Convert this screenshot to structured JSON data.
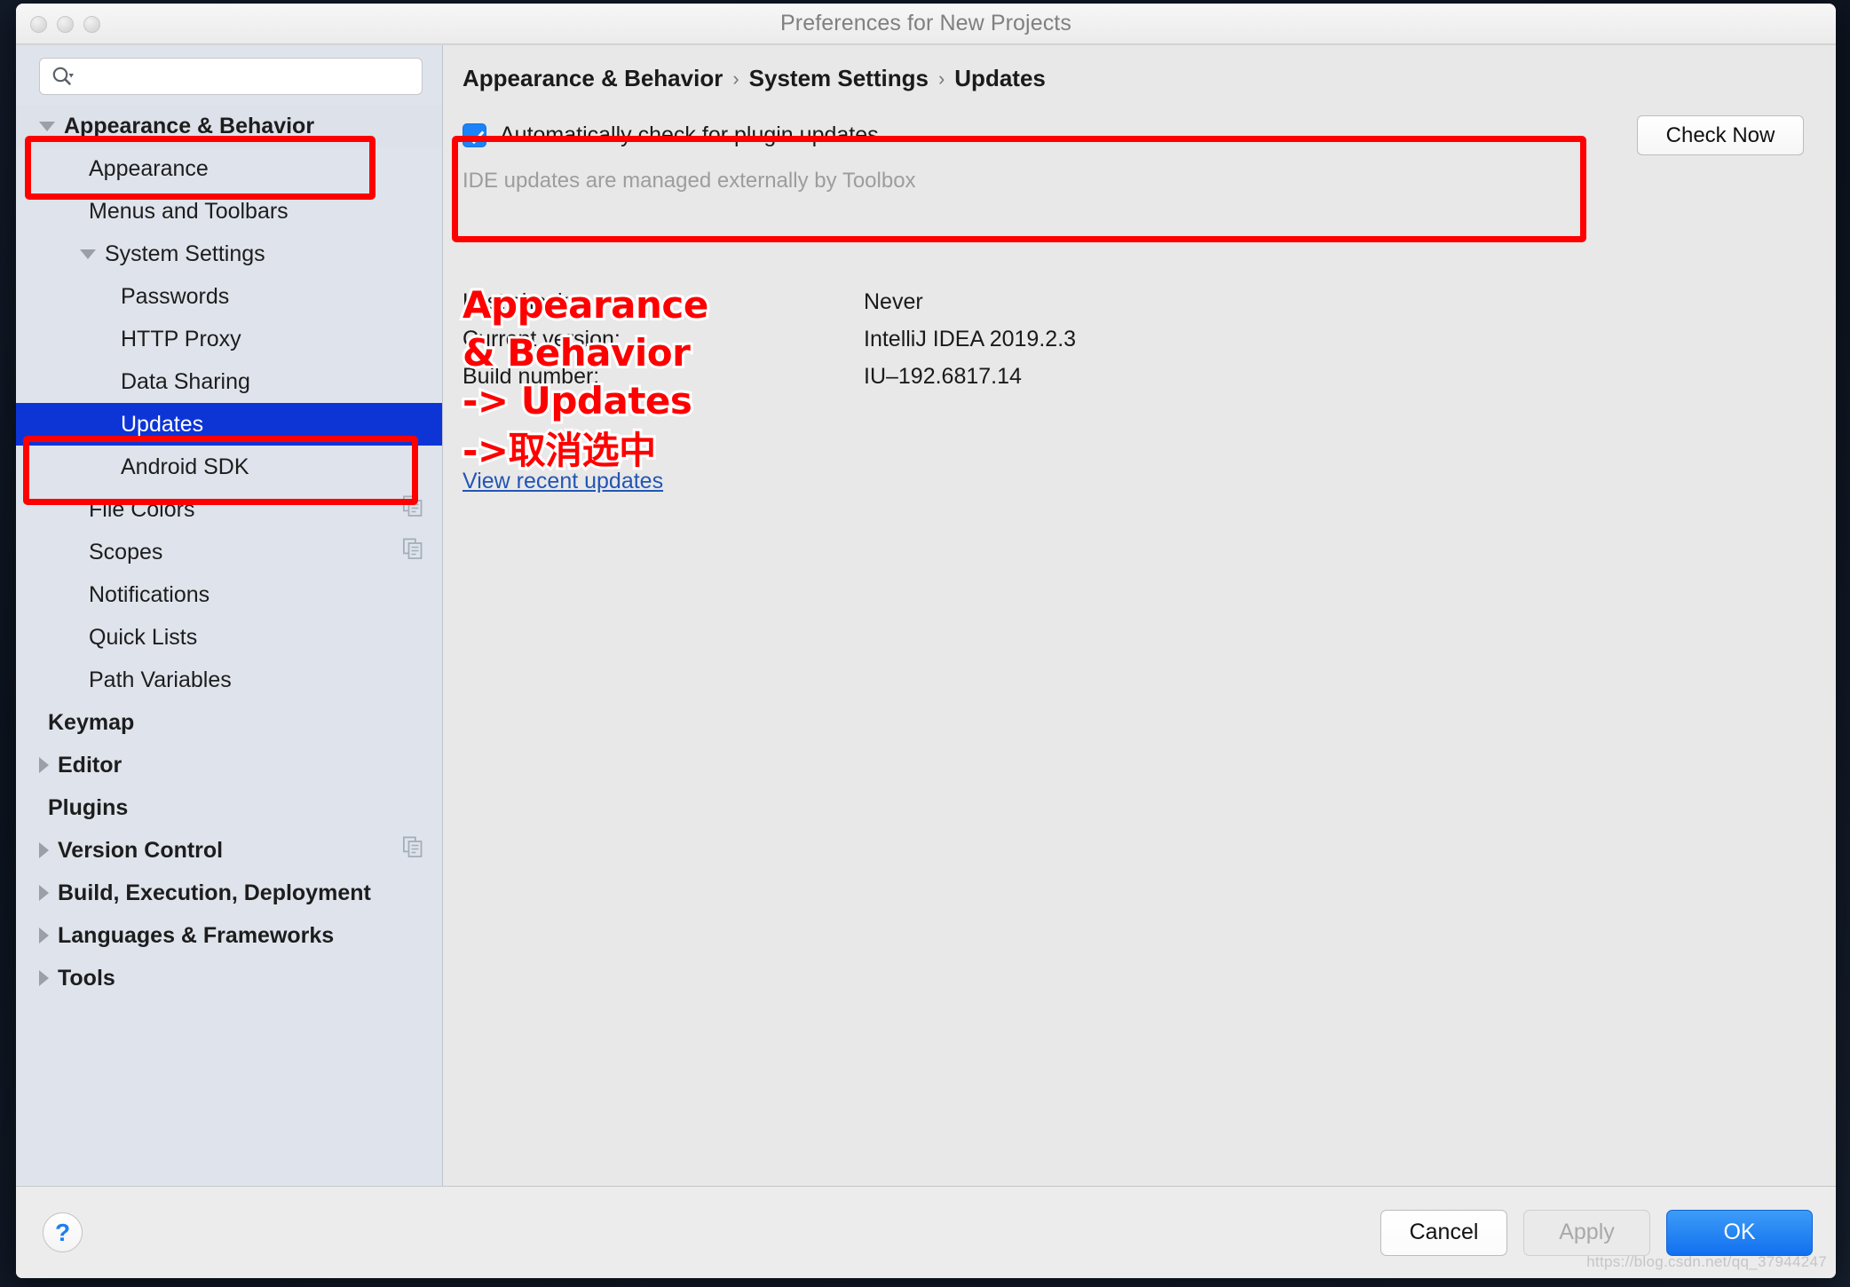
{
  "window": {
    "title": "Preferences for New Projects",
    "traffic_lights": [
      "close",
      "minimize",
      "zoom"
    ]
  },
  "sidebar": {
    "search": {
      "value": "",
      "placeholder": "",
      "icon": "search-icon"
    },
    "items": [
      {
        "label": "Appearance & Behavior",
        "level": 0,
        "arrow": "down",
        "bold": true,
        "selected": false,
        "framed": true,
        "copy_icon": false
      },
      {
        "label": "Appearance",
        "level": 1,
        "arrow": "none",
        "bold": false,
        "selected": false,
        "framed": false,
        "copy_icon": false
      },
      {
        "label": "Menus and Toolbars",
        "level": 1,
        "arrow": "none",
        "bold": false,
        "selected": false,
        "framed": false,
        "copy_icon": false
      },
      {
        "label": "System Settings",
        "level": 1,
        "arrow": "down",
        "bold": false,
        "selected": false,
        "framed": false,
        "copy_icon": false
      },
      {
        "label": "Passwords",
        "level": 2,
        "arrow": "none",
        "bold": false,
        "selected": false,
        "framed": false,
        "copy_icon": false
      },
      {
        "label": "HTTP Proxy",
        "level": 2,
        "arrow": "none",
        "bold": false,
        "selected": false,
        "framed": false,
        "copy_icon": false
      },
      {
        "label": "Data Sharing",
        "level": 2,
        "arrow": "none",
        "bold": false,
        "selected": false,
        "framed": false,
        "copy_icon": false
      },
      {
        "label": "Updates",
        "level": 2,
        "arrow": "none",
        "bold": false,
        "selected": true,
        "framed": false,
        "copy_icon": false
      },
      {
        "label": "Android SDK",
        "level": 2,
        "arrow": "none",
        "bold": false,
        "selected": false,
        "framed": false,
        "copy_icon": false
      },
      {
        "label": "File Colors",
        "level": 1,
        "arrow": "none",
        "bold": false,
        "selected": false,
        "framed": false,
        "copy_icon": true
      },
      {
        "label": "Scopes",
        "level": 1,
        "arrow": "none",
        "bold": false,
        "selected": false,
        "framed": false,
        "copy_icon": true
      },
      {
        "label": "Notifications",
        "level": 1,
        "arrow": "none",
        "bold": false,
        "selected": false,
        "framed": false,
        "copy_icon": false
      },
      {
        "label": "Quick Lists",
        "level": 1,
        "arrow": "none",
        "bold": false,
        "selected": false,
        "framed": false,
        "copy_icon": false
      },
      {
        "label": "Path Variables",
        "level": 1,
        "arrow": "none",
        "bold": false,
        "selected": false,
        "framed": false,
        "copy_icon": false
      },
      {
        "label": "Keymap",
        "level": 0,
        "arrow": "none",
        "bold": true,
        "selected": false,
        "framed": false,
        "copy_icon": false
      },
      {
        "label": "Editor",
        "level": 0,
        "arrow": "right",
        "bold": true,
        "selected": false,
        "framed": false,
        "copy_icon": false
      },
      {
        "label": "Plugins",
        "level": 0,
        "arrow": "none",
        "bold": true,
        "selected": false,
        "framed": false,
        "copy_icon": false
      },
      {
        "label": "Version Control",
        "level": 0,
        "arrow": "right",
        "bold": true,
        "selected": false,
        "framed": false,
        "copy_icon": true
      },
      {
        "label": "Build, Execution, Deployment",
        "level": 0,
        "arrow": "right",
        "bold": true,
        "selected": false,
        "framed": false,
        "copy_icon": false
      },
      {
        "label": "Languages & Frameworks",
        "level": 0,
        "arrow": "right",
        "bold": true,
        "selected": false,
        "framed": false,
        "copy_icon": false
      },
      {
        "label": "Tools",
        "level": 0,
        "arrow": "right",
        "bold": true,
        "selected": false,
        "framed": false,
        "copy_icon": false
      }
    ]
  },
  "content": {
    "breadcrumb": {
      "parts": [
        "Appearance & Behavior",
        "System Settings",
        "Updates"
      ],
      "separator": "›"
    },
    "updates_panel": {
      "checkbox_label": "Automatically check for plugin updates",
      "checkbox_checked": true,
      "check_now_label": "Check Now",
      "toolbox_note": "IDE updates are managed externally by Toolbox"
    },
    "info_rows": [
      {
        "label": "Last check:",
        "value": "Never"
      },
      {
        "label": "Current version:",
        "value": "IntelliJ IDEA 2019.2.3"
      },
      {
        "label": "Build number:",
        "value": "IU–192.6817.14"
      }
    ],
    "view_link": "View recent updates"
  },
  "annotations": {
    "color": "#ff0000",
    "texts": [
      "Appearance",
      "& Behavior",
      "-> Updates",
      "->取消选中"
    ]
  },
  "footer": {
    "help_label": "?",
    "cancel_label": "Cancel",
    "apply_label": "Apply",
    "apply_disabled": true,
    "ok_label": "OK"
  },
  "watermark": "https://blog.csdn.net/qq_37944247"
}
